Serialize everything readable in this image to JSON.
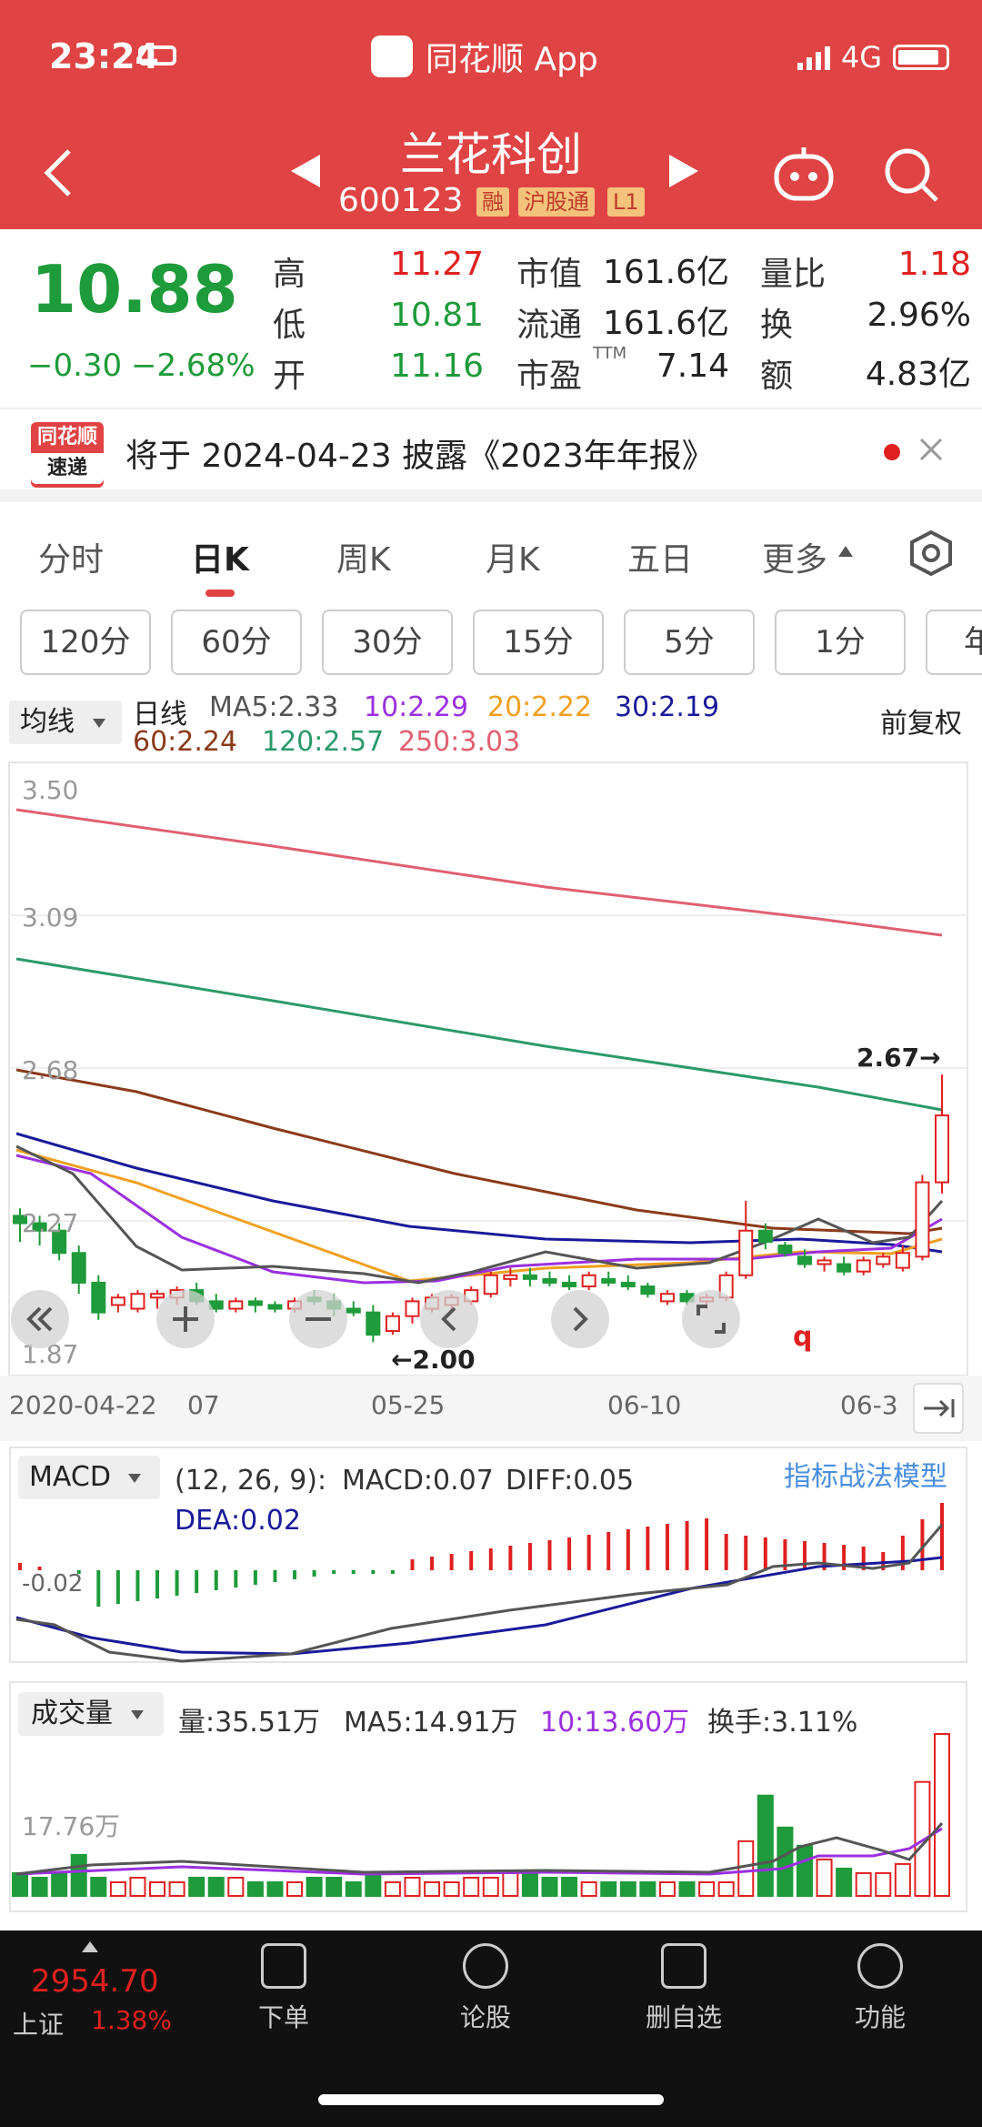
{
  "status": {
    "time": "23:24",
    "app": "同花顺 App",
    "network": "4G"
  },
  "stock": {
    "name": "兰花科创",
    "code": "600123",
    "tags": [
      "融",
      "沪股通",
      "L1"
    ]
  },
  "quote": {
    "price": "10.88",
    "change": "−0.30",
    "change_pct": "−2.68%",
    "high_label": "高",
    "high": "11.27",
    "low_label": "低",
    "low": "10.81",
    "open_label": "开",
    "open": "11.16",
    "mktcap_label": "市值",
    "mktcap": "161.6亿",
    "float_label": "流通",
    "float": "161.6亿",
    "pe_label": "市盈",
    "pe_sup": "TTM",
    "pe": "7.14",
    "vr_label": "量比",
    "vr": "1.18",
    "turn_label": "换",
    "turn": "2.96%",
    "amt_label": "额",
    "amt": "4.83亿"
  },
  "notice": {
    "logo_top": "同花顺",
    "logo_bottom": "速递",
    "text": "将于 2024-04-23 披露《2023年年报》"
  },
  "tabs": [
    "分时",
    "日K",
    "周K",
    "月K",
    "五日",
    "更多"
  ],
  "periods": [
    "120分",
    "60分",
    "30分",
    "15分",
    "5分",
    "1分",
    "年"
  ],
  "ma_panel": {
    "selector": "均线",
    "title": "日线",
    "adjust": "前复权",
    "ma5": "MA5:2.33",
    "ma10": "10:2.29",
    "ma20": "20:2.22",
    "ma30": "30:2.19",
    "ma60": "60:2.24",
    "ma120": "120:2.57",
    "ma250": "250:3.03"
  },
  "price_axis": [
    "3.50",
    "3.09",
    "2.68",
    "2.27",
    "1.87"
  ],
  "annotations": {
    "high_mark": "2.67→",
    "low_mark": "←2.00",
    "q": "q"
  },
  "dates": [
    "2020-04-22",
    "07",
    "05-25",
    "06-10",
    "06-3"
  ],
  "macd": {
    "selector": "MACD",
    "params": "(12, 26, 9):",
    "macd": "MACD:0.07",
    "diff": "DIFF:0.05",
    "dea": "DEA:0.02",
    "axis": "-0.02",
    "link": "指标战法模型"
  },
  "volume": {
    "selector": "成交量",
    "vol": "量:35.51万",
    "ma5": "MA5:14.91万",
    "ma10": "10:13.60万",
    "turnover": "换手:3.11%",
    "axis": "17.76万"
  },
  "bottom": {
    "index_value": "2954.70",
    "index_name": "上证",
    "index_pct": "1.38%",
    "nav": [
      "下单",
      "论股",
      "删自选",
      "功能"
    ]
  },
  "colors": {
    "header": "#e04343",
    "up": "#e02020",
    "down": "#1e9b3a"
  },
  "chart_data": {
    "type": "candlestick",
    "candles": [
      [
        2.29,
        2.31,
        2.22,
        2.27
      ],
      [
        2.27,
        2.29,
        2.21,
        2.25
      ],
      [
        2.25,
        2.27,
        2.17,
        2.19
      ],
      [
        2.19,
        2.21,
        2.08,
        2.11
      ],
      [
        2.11,
        2.13,
        2.01,
        2.03
      ],
      [
        2.05,
        2.08,
        2.03,
        2.07
      ],
      [
        2.04,
        2.09,
        2.03,
        2.08
      ],
      [
        2.07,
        2.09,
        2.04,
        2.08
      ],
      [
        2.07,
        2.1,
        2.05,
        2.09
      ],
      [
        2.09,
        2.11,
        2.05,
        2.06
      ],
      [
        2.06,
        2.08,
        2.03,
        2.04
      ],
      [
        2.04,
        2.07,
        2.03,
        2.06
      ],
      [
        2.06,
        2.07,
        2.03,
        2.05
      ],
      [
        2.05,
        2.06,
        2.03,
        2.04
      ],
      [
        2.04,
        2.07,
        2.03,
        2.06
      ],
      [
        2.07,
        2.09,
        2.05,
        2.06
      ],
      [
        2.06,
        2.08,
        2.02,
        2.04
      ],
      [
        2.04,
        2.06,
        2.02,
        2.03
      ],
      [
        2.03,
        2.05,
        1.95,
        1.97
      ],
      [
        1.98,
        2.03,
        1.97,
        2.02
      ],
      [
        2.02,
        2.07,
        2.0,
        2.06
      ],
      [
        2.04,
        2.08,
        2.03,
        2.07
      ],
      [
        2.05,
        2.08,
        2.04,
        2.07
      ],
      [
        2.06,
        2.1,
        2.05,
        2.09
      ],
      [
        2.08,
        2.14,
        2.07,
        2.13
      ],
      [
        2.12,
        2.15,
        2.1,
        2.13
      ],
      [
        2.13,
        2.15,
        2.1,
        2.12
      ],
      [
        2.12,
        2.14,
        2.1,
        2.11
      ],
      [
        2.11,
        2.13,
        2.09,
        2.1
      ],
      [
        2.1,
        2.14,
        2.09,
        2.13
      ],
      [
        2.12,
        2.14,
        2.1,
        2.11
      ],
      [
        2.11,
        2.13,
        2.09,
        2.1
      ],
      [
        2.1,
        2.11,
        2.07,
        2.08
      ],
      [
        2.06,
        2.09,
        2.05,
        2.08
      ],
      [
        2.08,
        2.09,
        2.05,
        2.06
      ],
      [
        2.06,
        2.08,
        2.04,
        2.07
      ],
      [
        2.07,
        2.14,
        2.06,
        2.13
      ],
      [
        2.13,
        2.33,
        2.12,
        2.25
      ],
      [
        2.25,
        2.27,
        2.2,
        2.22
      ],
      [
        2.21,
        2.22,
        2.18,
        2.19
      ],
      [
        2.18,
        2.2,
        2.15,
        2.16
      ],
      [
        2.16,
        2.18,
        2.14,
        2.17
      ],
      [
        2.16,
        2.18,
        2.13,
        2.14
      ],
      [
        2.14,
        2.18,
        2.13,
        2.17
      ],
      [
        2.16,
        2.19,
        2.15,
        2.18
      ],
      [
        2.15,
        2.21,
        2.14,
        2.19
      ],
      [
        2.18,
        2.4,
        2.17,
        2.38
      ],
      [
        2.38,
        2.67,
        2.35,
        2.56
      ]
    ],
    "volume": [
      5,
      4,
      5,
      9,
      4,
      3,
      4,
      3,
      3,
      4,
      4,
      4,
      3,
      3,
      3,
      4,
      4,
      3,
      5,
      3,
      4,
      3,
      3,
      4,
      4,
      5,
      5,
      4,
      4,
      3,
      3,
      3,
      3,
      3,
      3,
      3,
      3,
      12,
      22,
      15,
      11,
      8,
      6,
      5,
      5,
      7,
      25,
      35.51
    ],
    "ylim": [
      1.87,
      3.5
    ]
  }
}
